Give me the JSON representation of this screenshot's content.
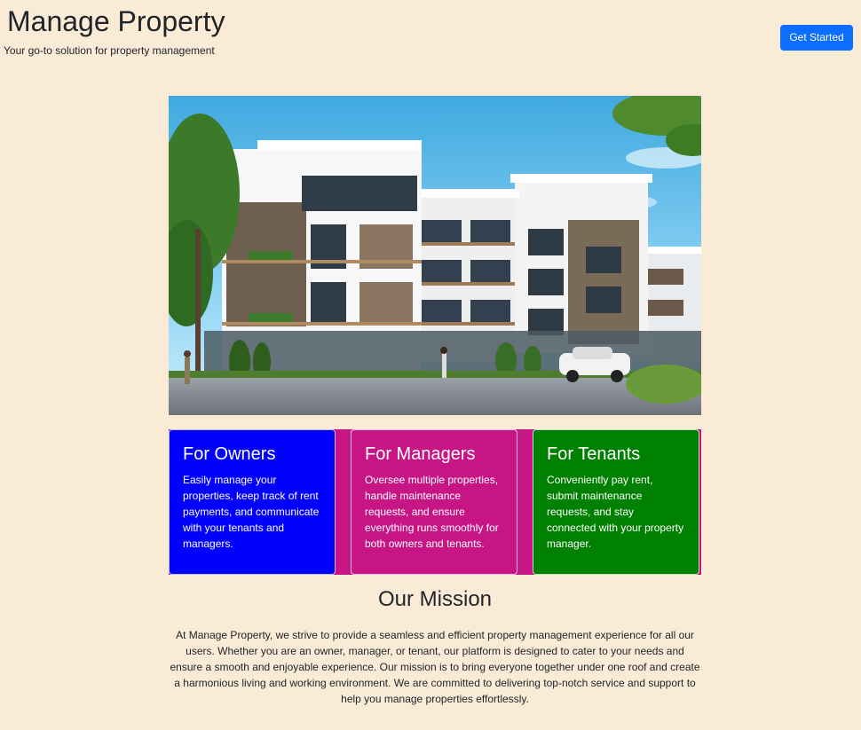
{
  "header": {
    "title": "Manage Property",
    "tagline": "Your go-to solution for property management",
    "cta_label": "Get Started"
  },
  "hero": {
    "alt": "Modern apartment building"
  },
  "cards": [
    {
      "title": "For Owners",
      "text": "Easily manage your properties, keep track of rent payments, and communicate with your tenants and managers.",
      "color": "#0000ff"
    },
    {
      "title": "For Managers",
      "text": "Oversee multiple properties, handle maintenance requests, and ensure everything runs smoothly for both owners and tenants.",
      "color": "#c71585"
    },
    {
      "title": "For Tenants",
      "text": "Conveniently pay rent, submit maintenance requests, and stay connected with your property manager.",
      "color": "#008000"
    }
  ],
  "mission": {
    "title": "Our Mission",
    "text": "At Manage Property, we strive to provide a seamless and efficient property management experience for all our users. Whether you are an owner, manager, or tenant, our platform is designed to cater to your needs and ensure a smooth and enjoyable experience. Our mission is to bring everyone together under one roof and create a harmonious living and working environment. We are committed to delivering top-notch service and support to help you manage properties effortlessly."
  },
  "colors": {
    "background": "#faebd7",
    "accent": "#0d6efd"
  }
}
